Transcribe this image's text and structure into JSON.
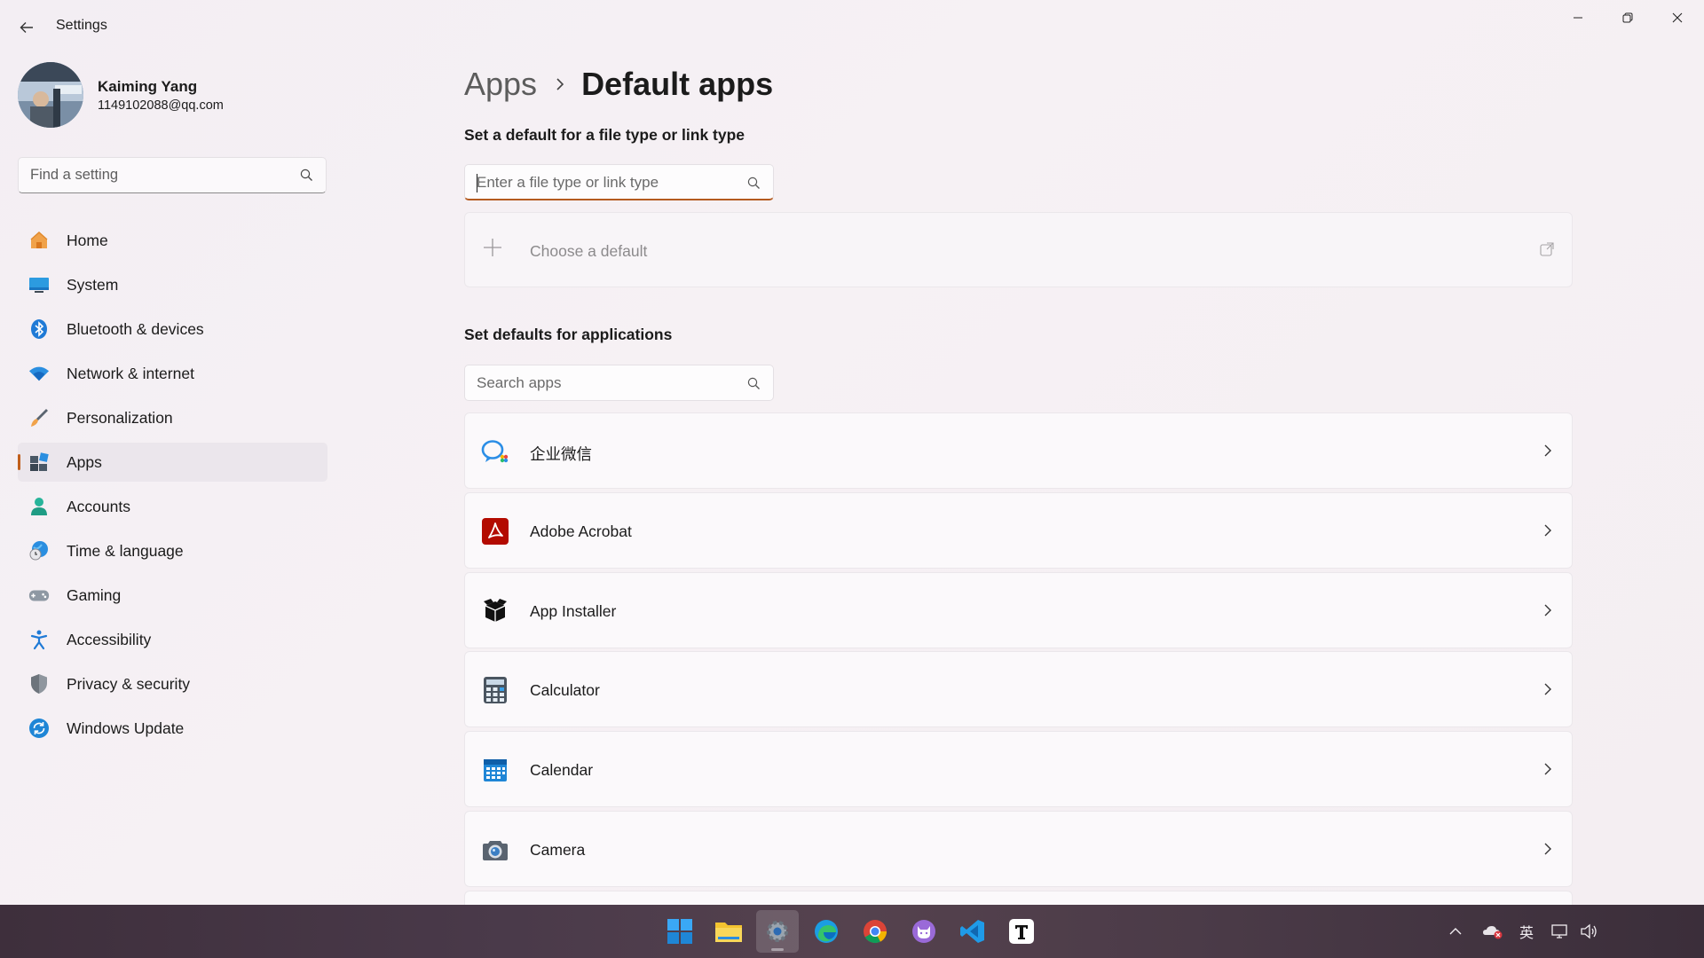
{
  "window": {
    "title": "Settings"
  },
  "profile": {
    "name": "Kaiming Yang",
    "email": "1149102088@qq.com"
  },
  "sidebar": {
    "search_placeholder": "Find a setting",
    "items": [
      {
        "label": "Home",
        "icon": "home-icon"
      },
      {
        "label": "System",
        "icon": "system-icon"
      },
      {
        "label": "Bluetooth & devices",
        "icon": "bluetooth-icon"
      },
      {
        "label": "Network & internet",
        "icon": "wifi-icon"
      },
      {
        "label": "Personalization",
        "icon": "brush-icon"
      },
      {
        "label": "Apps",
        "icon": "apps-icon",
        "active": true
      },
      {
        "label": "Accounts",
        "icon": "account-icon"
      },
      {
        "label": "Time & language",
        "icon": "globe-clock-icon"
      },
      {
        "label": "Gaming",
        "icon": "gamepad-icon"
      },
      {
        "label": "Accessibility",
        "icon": "accessibility-icon"
      },
      {
        "label": "Privacy & security",
        "icon": "shield-icon"
      },
      {
        "label": "Windows Update",
        "icon": "update-icon"
      }
    ]
  },
  "main": {
    "breadcrumb": {
      "parent": "Apps",
      "current": "Default apps"
    },
    "filetype_section": {
      "title": "Set a default for a file type or link type",
      "search_placeholder": "Enter a file type or link type",
      "choose_label": "Choose a default"
    },
    "apps_section": {
      "title": "Set defaults for applications",
      "search_placeholder": "Search apps",
      "apps": [
        {
          "name": "企业微信",
          "icon": "wecom-icon"
        },
        {
          "name": "Adobe Acrobat",
          "icon": "acrobat-icon"
        },
        {
          "name": "App Installer",
          "icon": "app-installer-icon"
        },
        {
          "name": "Calculator",
          "icon": "calculator-icon"
        },
        {
          "name": "Calendar",
          "icon": "calendar-icon"
        },
        {
          "name": "Camera",
          "icon": "camera-icon"
        }
      ]
    }
  },
  "taskbar": {
    "apps": [
      "windows-start-icon",
      "file-explorer-icon",
      "settings-icon",
      "edge-icon",
      "chrome-icon",
      "cat-app-icon",
      "vscode-icon",
      "typora-icon"
    ],
    "tray": {
      "ime": "英"
    }
  },
  "colors": {
    "accent": "#c15f1c",
    "background": "#f4eff3"
  }
}
